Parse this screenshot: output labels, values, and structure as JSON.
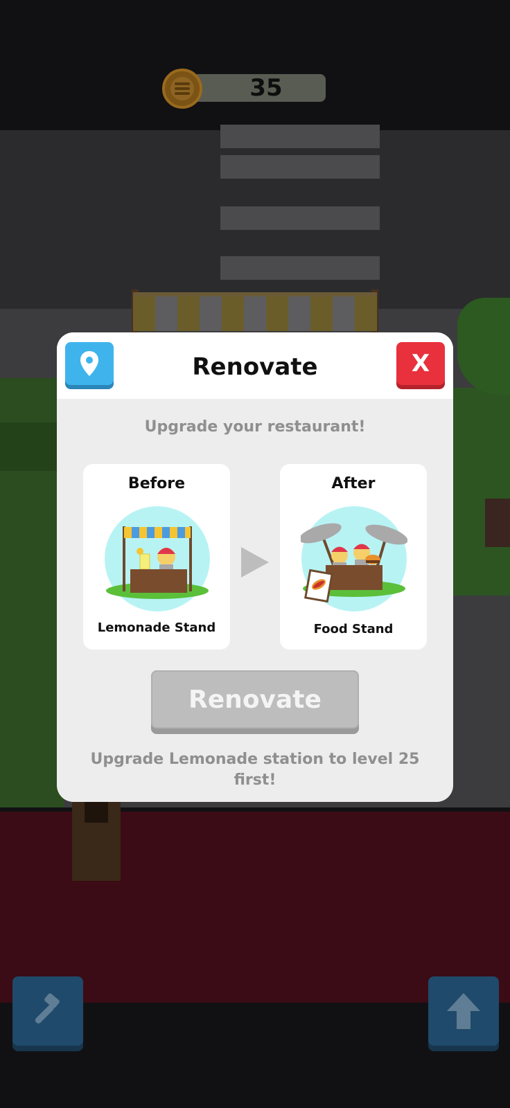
{
  "hud": {
    "coins": "35",
    "coin_icon": "burger-coin-icon"
  },
  "modal": {
    "title": "Renovate",
    "location_icon": "map-pin-icon",
    "close_label": "X",
    "subtitle": "Upgrade your restaurant!",
    "before": {
      "heading": "Before",
      "name": "Lemonade Stand"
    },
    "after": {
      "heading": "After",
      "name": "Food Stand"
    },
    "arrow_icon": "play-arrow-icon",
    "renovate_label": "Renovate",
    "renovate_enabled": false,
    "hint": "Upgrade Lemonade station to level 25 first!"
  },
  "toolbar": {
    "left_icon": "hammer-icon",
    "right_icon": "arrow-up-icon"
  },
  "colors": {
    "location_button": "#3fb4ec",
    "close_button": "#e8313c",
    "disabled_button": "#bdbdbd",
    "modal_background": "#ededed"
  }
}
